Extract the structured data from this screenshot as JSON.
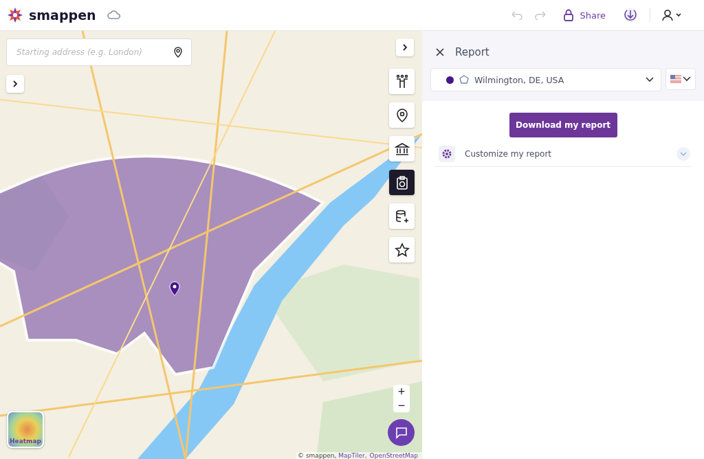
{
  "header": {
    "brand": "smappen",
    "share": "Share"
  },
  "map": {
    "search": {
      "placeholder": "Starting address (e.g. London)"
    },
    "tools": [
      {
        "kind": "population",
        "selected": false
      },
      {
        "kind": "pin",
        "selected": false
      },
      {
        "kind": "bank",
        "selected": false
      },
      {
        "kind": "report",
        "selected": true
      },
      {
        "kind": "database",
        "selected": false
      },
      {
        "kind": "star",
        "selected": false
      }
    ],
    "zoom_in": "+",
    "zoom_out": "−",
    "heatmap": "Heatmap",
    "attribution": {
      "text": "© smappen, ",
      "links": [
        "MapTiler,",
        "OpenStreetMap"
      ]
    }
  },
  "panel": {
    "title": "Report",
    "area": {
      "name": "Wilmington, DE, USA",
      "color": "#4a148c"
    },
    "download": "Download my report",
    "customize": {
      "label": "Customize my report",
      "expanded": false
    }
  }
}
